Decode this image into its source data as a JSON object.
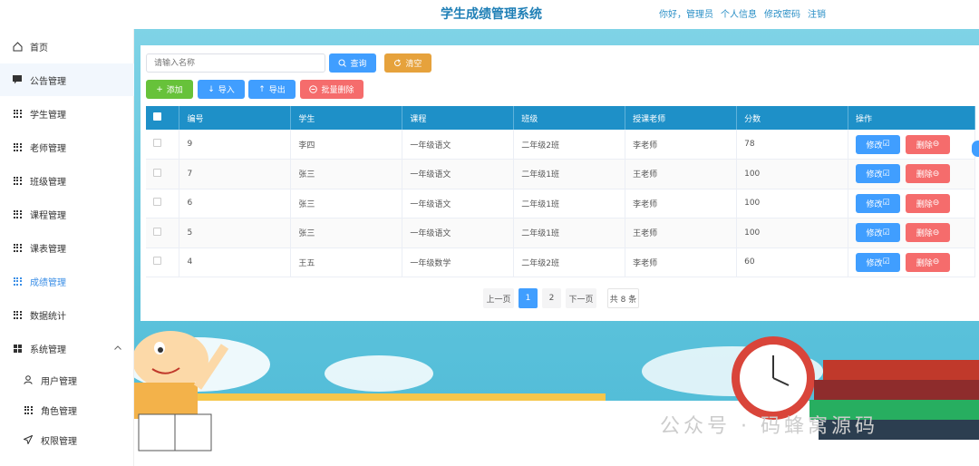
{
  "header": {
    "title": "学生成绩管理系统",
    "greeting": "你好，管理员",
    "profile": "个人信息",
    "change_password": "修改密码",
    "logout": "注销"
  },
  "sidebar": {
    "items": [
      {
        "label": "首页",
        "icon": "home-icon"
      },
      {
        "label": "公告管理",
        "icon": "message-icon"
      },
      {
        "label": "学生管理",
        "icon": "grid-icon"
      },
      {
        "label": "老师管理",
        "icon": "grid-icon"
      },
      {
        "label": "班级管理",
        "icon": "grid-icon"
      },
      {
        "label": "课程管理",
        "icon": "grid-icon"
      },
      {
        "label": "课表管理",
        "icon": "grid-icon"
      },
      {
        "label": "成绩管理",
        "icon": "grid-icon",
        "active": true
      },
      {
        "label": "数据统计",
        "icon": "grid-icon"
      },
      {
        "label": "系统管理",
        "icon": "apps-icon"
      },
      {
        "label": "用户管理",
        "icon": "user-icon"
      },
      {
        "label": "角色管理",
        "icon": "grid-icon"
      },
      {
        "label": "权限管理",
        "icon": "send-icon"
      }
    ]
  },
  "search": {
    "placeholder": "请输入名称",
    "query_label": "查询",
    "clear_label": "清空"
  },
  "toolbar": {
    "add_label": "添加",
    "import_label": "导入",
    "export_label": "导出",
    "batch_delete_label": "批量删除"
  },
  "table": {
    "columns": [
      "编号",
      "学生",
      "课程",
      "班级",
      "授课老师",
      "分数",
      "操作"
    ],
    "rows": [
      {
        "id": "9",
        "student": "李四",
        "course": "一年级语文",
        "class": "二年级2班",
        "teacher": "李老师",
        "score": "78"
      },
      {
        "id": "7",
        "student": "张三",
        "course": "一年级语文",
        "class": "二年级1班",
        "teacher": "王老师",
        "score": "100"
      },
      {
        "id": "6",
        "student": "张三",
        "course": "一年级语文",
        "class": "二年级1班",
        "teacher": "李老师",
        "score": "100"
      },
      {
        "id": "5",
        "student": "张三",
        "course": "一年级语文",
        "class": "二年级1班",
        "teacher": "王老师",
        "score": "100"
      },
      {
        "id": "4",
        "student": "王五",
        "course": "一年级数学",
        "class": "二年级2班",
        "teacher": "李老师",
        "score": "60"
      }
    ],
    "edit_label": "修改",
    "delete_label": "删除"
  },
  "pagination": {
    "prev": "上一页",
    "pages": [
      "1",
      "2"
    ],
    "current": "1",
    "next": "下一页",
    "total": "共 8 条"
  },
  "watermark": "公众号 · 码蜂窝源码",
  "colors": {
    "header_title": "#1f7fb6",
    "table_header": "#1e90c8",
    "primary": "#409eff",
    "danger": "#f56c6c",
    "warning": "#e6a23c",
    "success": "#67c23a"
  }
}
